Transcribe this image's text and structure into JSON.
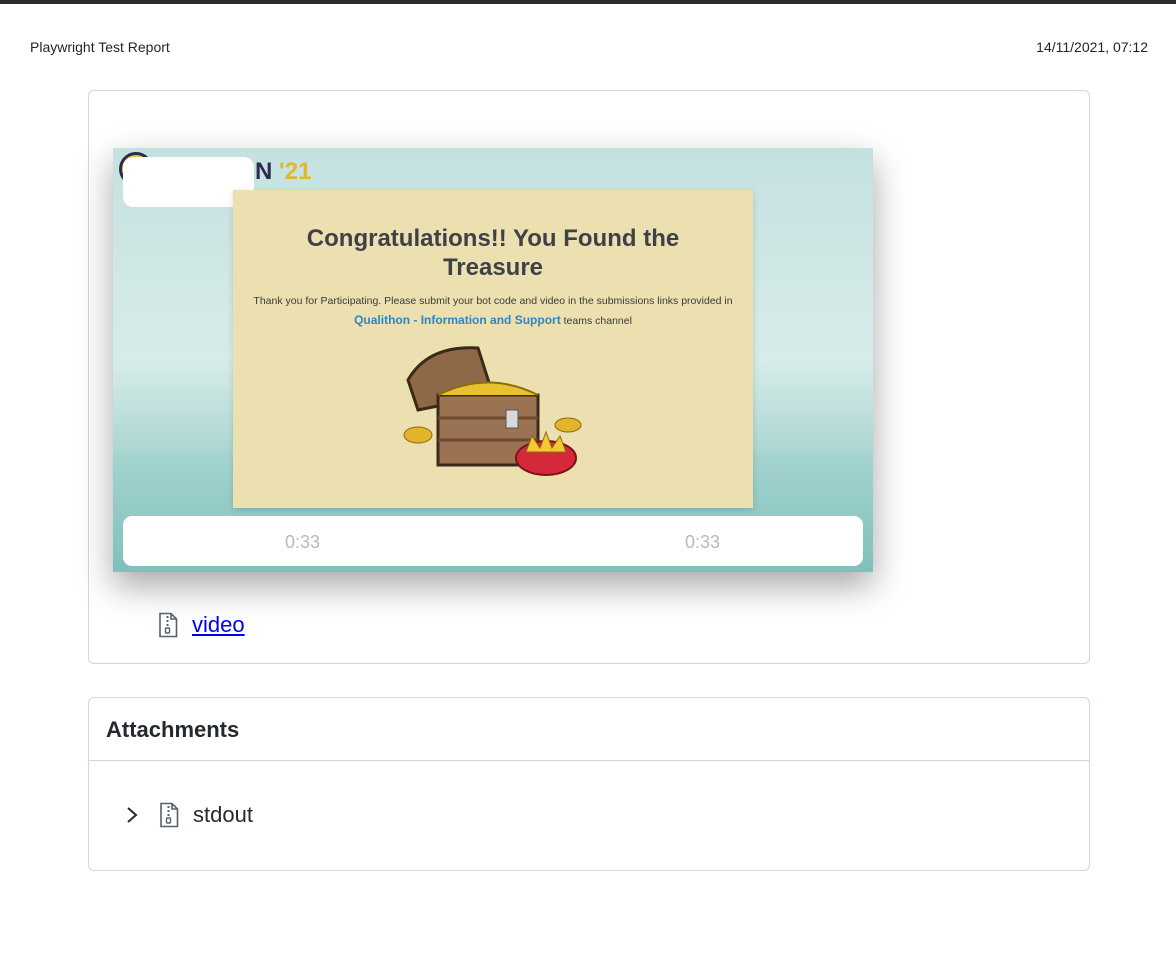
{
  "header": {
    "title": "Playwright Test Report",
    "date": "14/11/2021, 07:12"
  },
  "video": {
    "brand_text": "N",
    "brand_year": "'21",
    "card_title": "Congratulations!! You Found the Treasure",
    "card_text_before": "Thank you for Participating. Please submit your bot code and video in the submissions links provided in ",
    "card_link": "Qualithon - Information and Support",
    "card_text_after": " teams channel",
    "time_current": "0:33",
    "time_total": "0:33",
    "link_label": "video",
    "link_icon": "zip-file-icon"
  },
  "attachments": {
    "heading": "Attachments",
    "items": [
      {
        "label": "stdout",
        "icon": "zip-file-icon",
        "expand_icon": "chevron-right-icon"
      }
    ]
  },
  "colors": {
    "link": "#0000ee",
    "border": "#d0d7de",
    "card_bg": "#ecdfb0",
    "accent_link": "#2b86c5"
  }
}
